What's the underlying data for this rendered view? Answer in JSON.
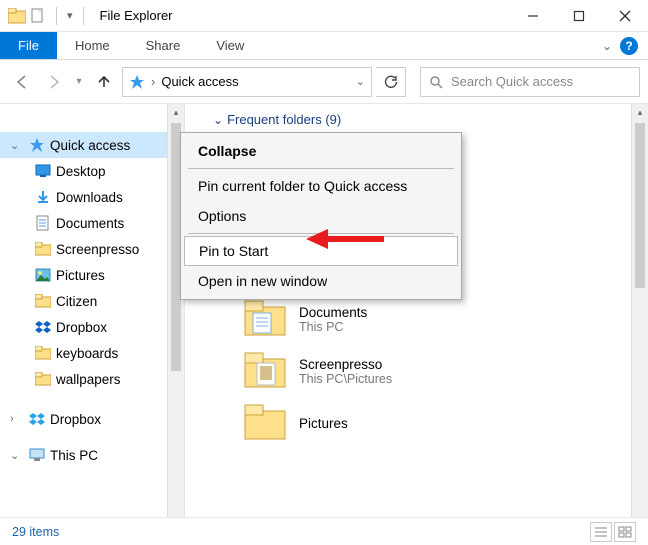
{
  "titlebar": {
    "app_title": "File Explorer"
  },
  "ribbon": {
    "file": "File",
    "home": "Home",
    "share": "Share",
    "view": "View"
  },
  "nav": {
    "address_text": "Quick access",
    "search_placeholder": "Search Quick access"
  },
  "tree": {
    "quick_access": "Quick access",
    "items": [
      {
        "label": "Desktop"
      },
      {
        "label": "Downloads"
      },
      {
        "label": "Documents"
      },
      {
        "label": "Screenpresso"
      },
      {
        "label": "Pictures"
      },
      {
        "label": "Citizen"
      },
      {
        "label": "Dropbox"
      },
      {
        "label": "keyboards"
      },
      {
        "label": "wallpapers"
      }
    ],
    "dropbox": "Dropbox",
    "this_pc": "This PC"
  },
  "content": {
    "frequent_heading": "Frequent folders (9)",
    "rows": [
      {
        "name": "Documents",
        "loc": "This PC"
      },
      {
        "name": "Screenpresso",
        "loc": "This PC\\Pictures"
      },
      {
        "name": "Pictures",
        "loc": ""
      }
    ]
  },
  "context_menu": {
    "collapse": "Collapse",
    "pin_quick": "Pin current folder to Quick access",
    "options": "Options",
    "pin_start": "Pin to Start",
    "open_new": "Open in new window"
  },
  "status": {
    "count": "29 items"
  }
}
